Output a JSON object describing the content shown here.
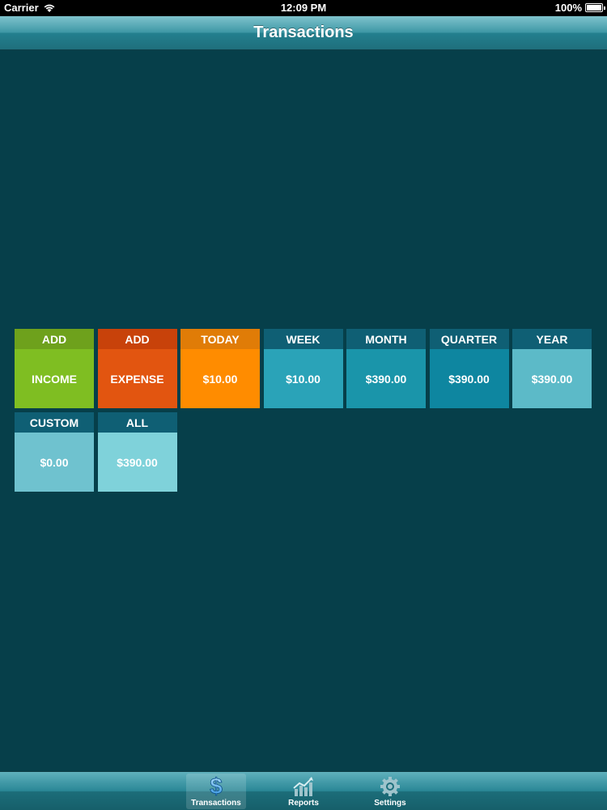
{
  "status_bar": {
    "carrier": "Carrier",
    "time": "12:09 PM",
    "battery": "100%"
  },
  "nav": {
    "title": "Transactions"
  },
  "tiles": [
    {
      "label": "ADD",
      "value": "INCOME",
      "head_color": "#6ea11c",
      "body_color": "#7fbe22"
    },
    {
      "label": "ADD",
      "value": "EXPENSE",
      "head_color": "#c8420a",
      "body_color": "#e25510"
    },
    {
      "label": "TODAY",
      "value": "$10.00",
      "head_color": "#e07c07",
      "body_color": "#ff8c00"
    },
    {
      "label": "WEEK",
      "value": "$10.00",
      "head_color": "#0f5f74",
      "body_color": "#2aa3b8"
    },
    {
      "label": "MONTH",
      "value": "$390.00",
      "head_color": "#0f5f74",
      "body_color": "#1a95aa"
    },
    {
      "label": "QUARTER",
      "value": "$390.00",
      "head_color": "#0f5f74",
      "body_color": "#0e86a0"
    },
    {
      "label": "YEAR",
      "value": "$390.00",
      "head_color": "#0f5f74",
      "body_color": "#5cbac8"
    },
    {
      "label": "CUSTOM",
      "value": "$0.00",
      "head_color": "#0f5f74",
      "body_color": "#6fc2cf"
    },
    {
      "label": "ALL",
      "value": "$390.00",
      "head_color": "#0f5f74",
      "body_color": "#7fd2da"
    }
  ],
  "tab_bar": {
    "items": [
      {
        "label": "Transactions",
        "icon": "dollar-icon",
        "selected": true
      },
      {
        "label": "Reports",
        "icon": "chart-icon",
        "selected": false
      },
      {
        "label": "Settings",
        "icon": "gear-icon",
        "selected": false
      }
    ]
  }
}
